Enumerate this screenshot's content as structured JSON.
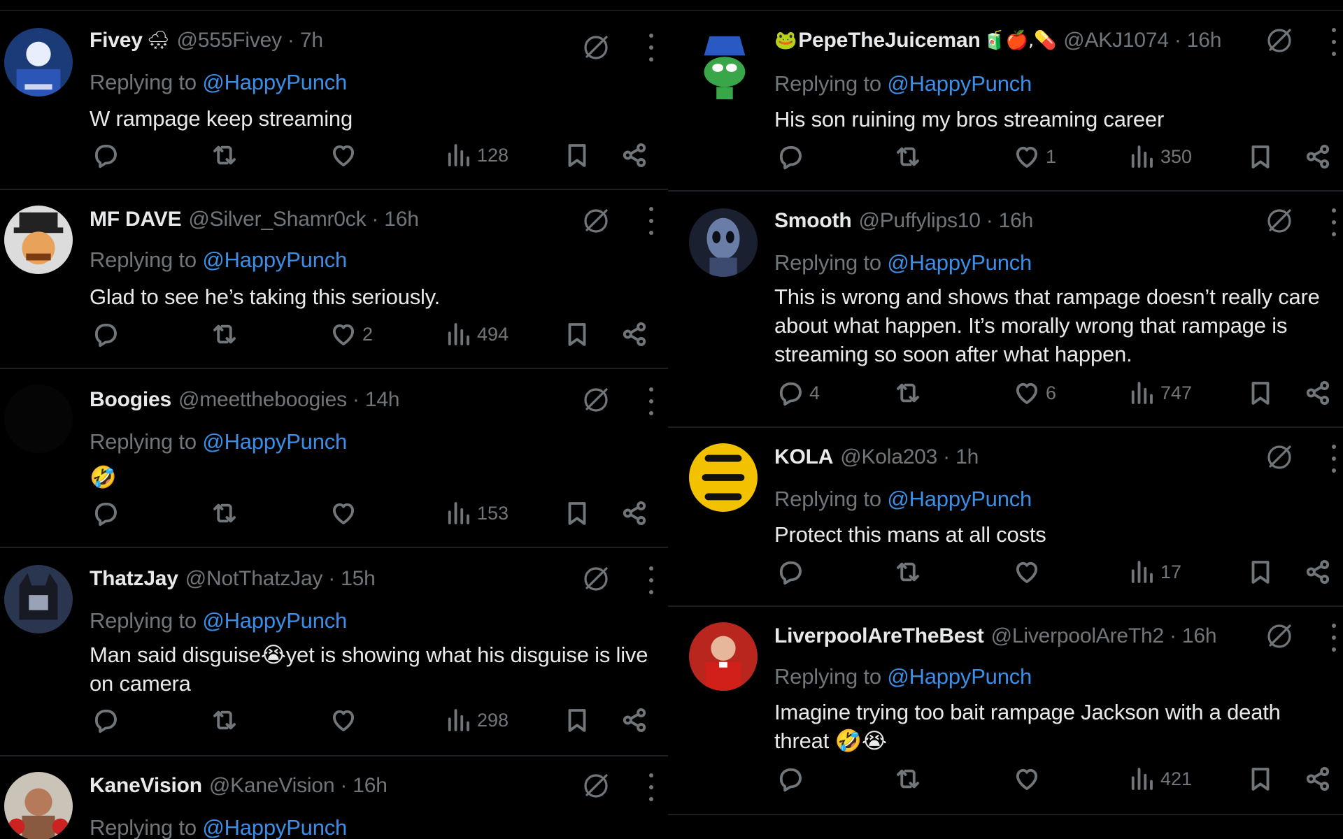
{
  "reply_prefix": "Replying to ",
  "left_column": [
    {
      "name": "Fivey",
      "name_emoji": "🌨",
      "handle": "@555Fivey",
      "time": "· 7h",
      "reply_to": "@HappyPunch",
      "text": "W rampage keep streaming",
      "replies": "",
      "reposts": "",
      "likes": "",
      "views": "128"
    },
    {
      "name": "MF DAVE",
      "name_emoji": "",
      "handle": "@Silver_Shamr0ck",
      "time": "· 16h",
      "reply_to": "@HappyPunch",
      "text": "Glad to see he’s taking this seriously.",
      "replies": "",
      "reposts": "",
      "likes": "2",
      "views": "494"
    },
    {
      "name": "Boogies",
      "name_emoji": "",
      "handle": "@meettheboogies",
      "time": "· 14h",
      "reply_to": "@HappyPunch",
      "text": "🤣",
      "replies": "",
      "reposts": "",
      "likes": "",
      "views": "153"
    },
    {
      "name": "ThatzJay",
      "name_emoji": "",
      "handle": "@NotThatzJay",
      "time": "· 15h",
      "reply_to": "@HappyPunch",
      "text": "Man said disguise😭yet is showing what his disguise is live on camera",
      "replies": "",
      "reposts": "",
      "likes": "",
      "views": "298"
    },
    {
      "name": "KaneVision",
      "name_emoji": "",
      "handle": "@KaneVision",
      "time": "· 16h",
      "reply_to": "@HappyPunch",
      "text": "",
      "replies": "",
      "reposts": "",
      "likes": "",
      "views": ""
    }
  ],
  "right_column": [
    {
      "name": "PepeTheJuiceman",
      "name_emoji_prefix": "🐸",
      "name_emoji": "🧃🍎,💊",
      "handle": "@AKJ1074",
      "time": "· 16h",
      "reply_to": "@HappyPunch",
      "text": "His son ruining my bros streaming career",
      "replies": "",
      "reposts": "",
      "likes": "1",
      "views": "350"
    },
    {
      "name": "Smooth",
      "name_emoji_prefix": "",
      "name_emoji": "",
      "handle": "@Puffylips10",
      "time": "· 16h",
      "reply_to": "@HappyPunch",
      "text": "This is wrong and shows that rampage  doesn’t really care about what happen. It’s morally wrong that rampage is streaming so soon after what happen.",
      "replies": "4",
      "reposts": "",
      "likes": "6",
      "views": "747"
    },
    {
      "name": "KOLA",
      "name_emoji_prefix": "",
      "name_emoji": "",
      "handle": "@Kola203",
      "time": "· 1h",
      "reply_to": "@HappyPunch",
      "text": "Protect this mans at all costs",
      "replies": "",
      "reposts": "",
      "likes": "",
      "views": "17"
    },
    {
      "name": "LiverpoolAreTheBest",
      "name_emoji_prefix": "",
      "name_emoji": "",
      "handle": "@LiverpoolAreTh2",
      "time": "· 16h",
      "reply_to": "@HappyPunch",
      "text": "Imagine trying too bait rampage Jackson with a death threat 🤣😭",
      "replies": "",
      "reposts": "",
      "likes": "",
      "views": "421"
    }
  ],
  "icons": {
    "reply": "reply-icon",
    "repost": "repost-icon",
    "like": "heart-icon",
    "views": "views-icon",
    "bookmark": "bookmark-icon",
    "share": "share-icon",
    "grok": "grok-icon",
    "more": "more-icon"
  },
  "colors": {
    "background": "#000000",
    "text": "#e7e9ea",
    "muted": "#71767b",
    "mention": "#3b8fe6",
    "divider": "#1d1f23"
  }
}
